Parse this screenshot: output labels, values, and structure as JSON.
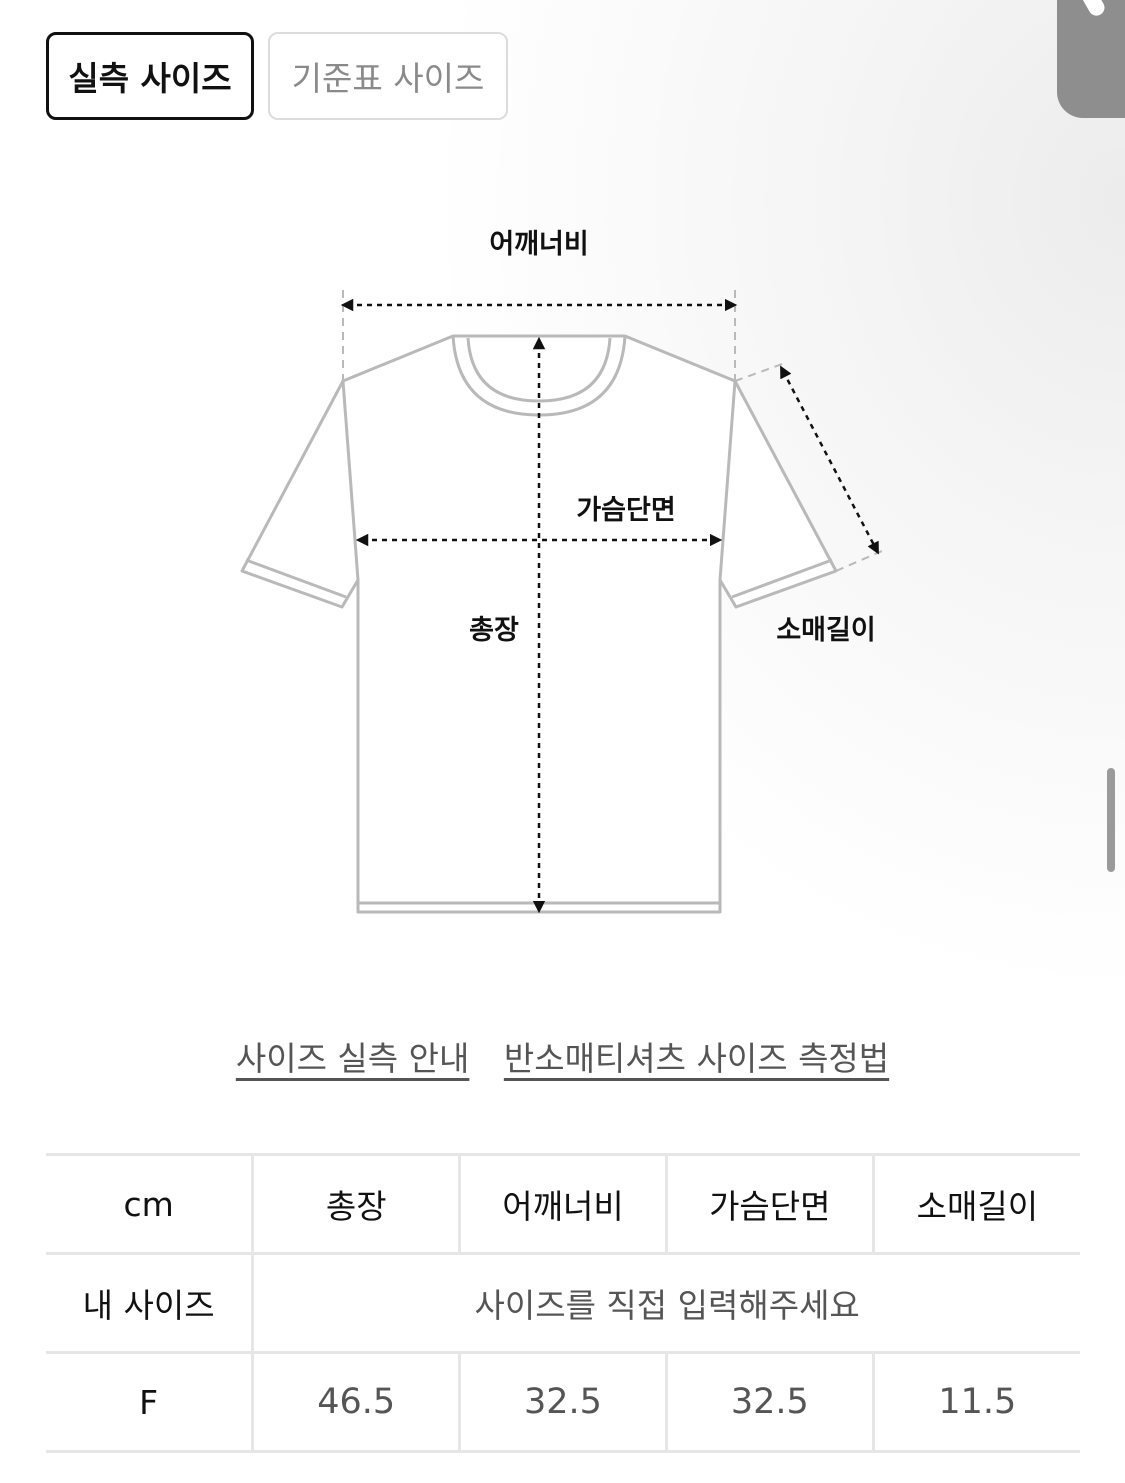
{
  "tabs": [
    {
      "label": "실측 사이즈",
      "active": true
    },
    {
      "label": "기준표 사이즈",
      "active": false
    }
  ],
  "diagram": {
    "labels": {
      "shoulder": "어깨너비",
      "chest": "가슴단면",
      "length": "총장",
      "sleeve": "소매길이"
    }
  },
  "links": [
    "사이즈 실측 안내",
    "반소매티셔츠 사이즈 측정법"
  ],
  "table": {
    "headers": [
      "cm",
      "총장",
      "어깨너비",
      "가슴단면",
      "소매길이"
    ],
    "my_size": {
      "label": "내 사이즈",
      "placeholder": "사이즈를 직접 입력해주세요"
    },
    "rows": [
      {
        "size": "F",
        "values": [
          "46.5",
          "32.5",
          "32.5",
          "11.5"
        ]
      }
    ]
  },
  "colors": {
    "active_border": "#111111",
    "inactive_border": "#dcdcdc",
    "divider": "#e6e6e6"
  }
}
